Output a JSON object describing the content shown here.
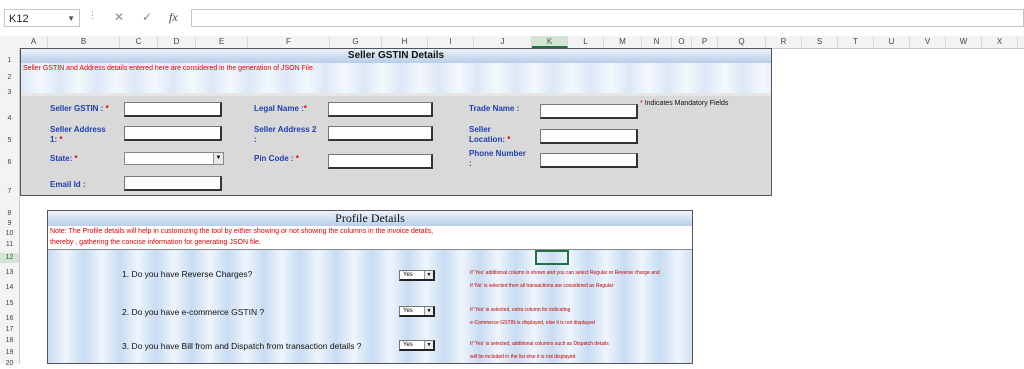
{
  "formula_bar": {
    "name_box": "K12",
    "cancel_icon": "✕",
    "enter_icon": "✓",
    "fx_label": "fx",
    "formula": ""
  },
  "columns": [
    "A",
    "B",
    "C",
    "D",
    "E",
    "F",
    "G",
    "H",
    "I",
    "J",
    "K",
    "L",
    "M",
    "N",
    "O",
    "P",
    "Q",
    "R",
    "S",
    "T",
    "U",
    "V",
    "W",
    "X"
  ],
  "rows": [
    "1",
    "2",
    "3",
    "4",
    "5",
    "6",
    "7",
    "8",
    "9",
    "10",
    "11",
    "12",
    "13",
    "14",
    "15",
    "16",
    "17",
    "18",
    "19",
    "20"
  ],
  "selected_cell": {
    "column": "K",
    "row": "12"
  },
  "seller": {
    "title": "Seller GSTIN Details",
    "note": "Seller GSTIN and Address details entered here are considered in the generation of JSON File.",
    "mandatory_note": "Indicates Mandatory Fields",
    "req": "*",
    "fields": {
      "gstin": "Seller GSTIN :",
      "legal_name": "Legal Name :",
      "trade_name": "Trade Name :",
      "address1_a": "Seller Address",
      "address1_b": "1:",
      "address2_a": "Seller Address 2",
      "address2_b": ":",
      "location_a": "Seller",
      "location_b": "Location:",
      "state": "State:",
      "pin": "Pin Code :",
      "phone_a": "Phone Number",
      "phone_b": ":",
      "email": "Email Id :"
    },
    "values": {
      "gstin": "",
      "legal_name": "",
      "trade_name": "",
      "address1": "",
      "address2": "",
      "location": "",
      "state": "",
      "pin": "",
      "phone": "",
      "email": ""
    }
  },
  "profile": {
    "title": "Profile Details",
    "note_line1": "Note: The Profile details will help in customizing the tool by either showing or not showing the columns in the invoice details,",
    "note_line2": "thereby , gathering the  concise information for generating JSON file.",
    "questions": [
      {
        "text": "1. Do you have Reverse Charges?",
        "value": "Yes",
        "hint1": "If 'Yes' additional column is shown and you can select Regular or Reverse charge and",
        "hint2": "If 'No' is selected then all transactions are considered as Regular"
      },
      {
        "text": "2. Do you have e-commerce GSTIN ?",
        "value": "Yes",
        "hint1": "If 'Yes' is selected, extra column for indicating",
        "hint2": "e-Commerce GSTIN is displayed, else it is not displayed"
      },
      {
        "text": "3. Do you have Bill from and Dispatch from transaction details ?",
        "value": "Yes",
        "hint1": "If 'Yes' is selected, additional columns such as Dispatch details",
        "hint2": "will be included in the list else it is not displayed"
      }
    ]
  }
}
